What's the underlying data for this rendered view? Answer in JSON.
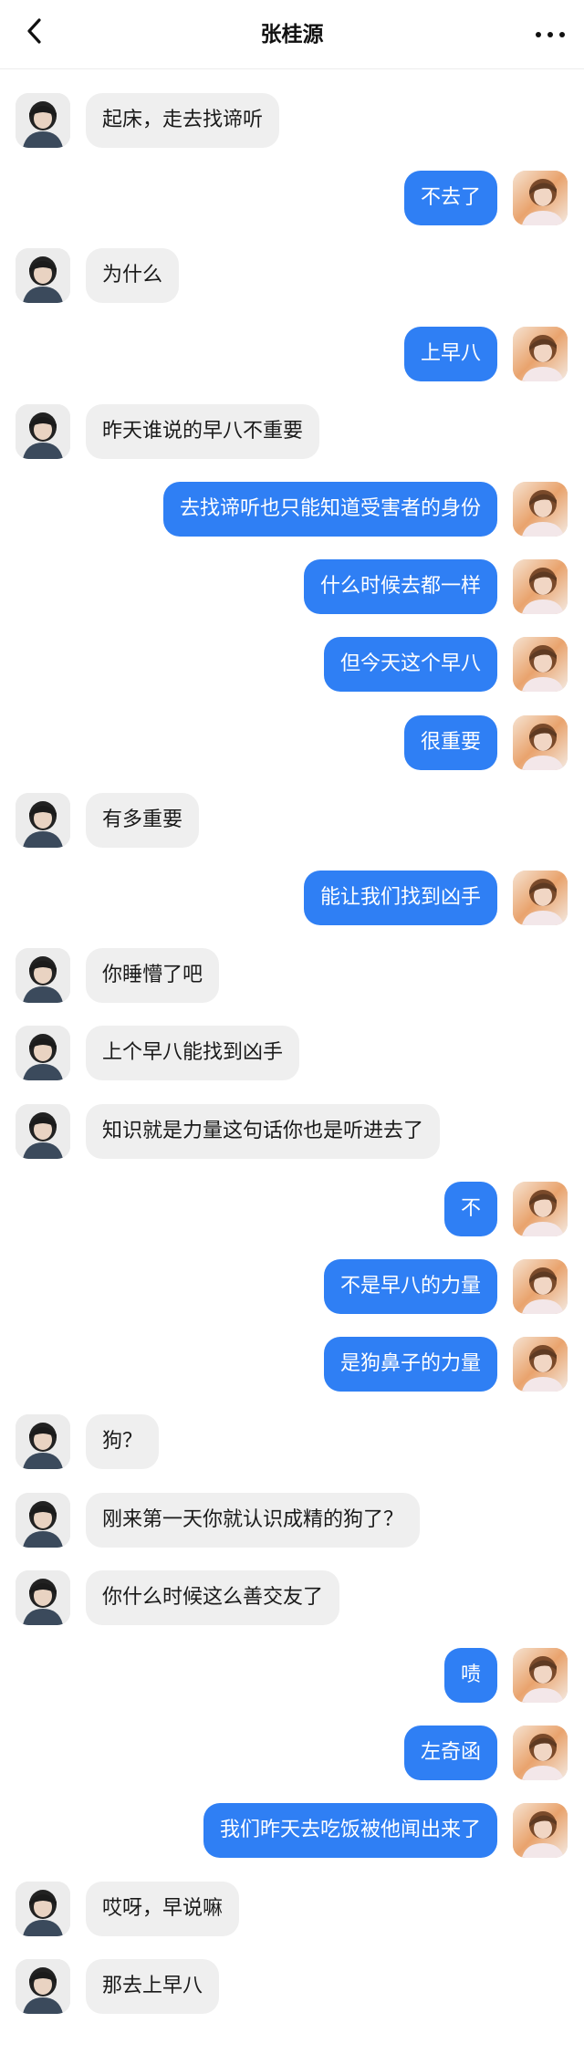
{
  "header": {
    "title": "张桂源",
    "back_icon": "chevron-left-icon",
    "more_icon": "more-dots-icon"
  },
  "colors": {
    "outgoing_bubble": "#2f7ff4",
    "incoming_bubble": "#efefef"
  },
  "messages": [
    {
      "side": "left",
      "text": "起床，走去找谛听"
    },
    {
      "side": "right",
      "text": "不去了"
    },
    {
      "side": "left",
      "text": "为什么"
    },
    {
      "side": "right",
      "text": "上早八"
    },
    {
      "side": "left",
      "text": "昨天谁说的早八不重要"
    },
    {
      "side": "right",
      "text": "去找谛听也只能知道受害者的身份"
    },
    {
      "side": "right",
      "text": "什么时候去都一样"
    },
    {
      "side": "right",
      "text": "但今天这个早八"
    },
    {
      "side": "right",
      "text": "很重要"
    },
    {
      "side": "left",
      "text": "有多重要"
    },
    {
      "side": "right",
      "text": "能让我们找到凶手"
    },
    {
      "side": "left",
      "text": "你睡懵了吧"
    },
    {
      "side": "left",
      "text": "上个早八能找到凶手"
    },
    {
      "side": "left",
      "text": "知识就是力量这句话你也是听进去了"
    },
    {
      "side": "right",
      "text": "不"
    },
    {
      "side": "right",
      "text": "不是早八的力量"
    },
    {
      "side": "right",
      "text": "是狗鼻子的力量"
    },
    {
      "side": "left",
      "text": "狗？"
    },
    {
      "side": "left",
      "text": "刚来第一天你就认识成精的狗了？"
    },
    {
      "side": "left",
      "text": "你什么时候这么善交友了"
    },
    {
      "side": "right",
      "text": "啧"
    },
    {
      "side": "right",
      "text": "左奇函"
    },
    {
      "side": "right",
      "text": "我们昨天去吃饭被他闻出来了"
    },
    {
      "side": "left",
      "text": "哎呀，早说嘛"
    },
    {
      "side": "left",
      "text": "那去上早八"
    }
  ]
}
